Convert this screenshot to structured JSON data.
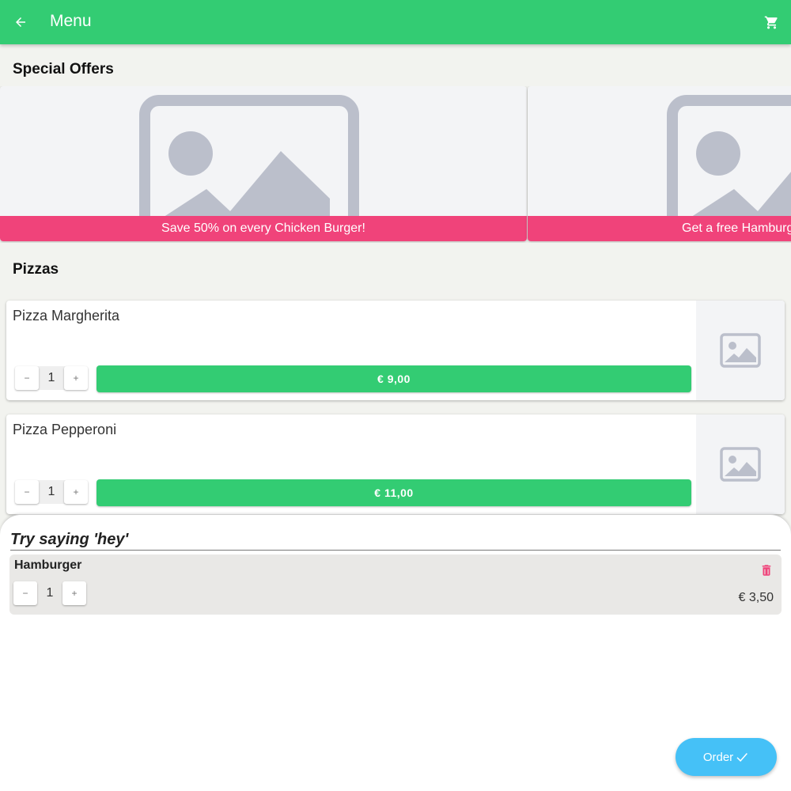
{
  "appbar": {
    "title": "Menu",
    "back_icon": "arrow-left-icon",
    "cart_icon": "cart-icon",
    "color": "#33cc73"
  },
  "offers": {
    "title": "Special Offers",
    "items": [
      {
        "label": "Save 50% on every Chicken Burger!"
      },
      {
        "label": "Get a free Hamburger"
      }
    ],
    "banner_color": "#f0437a"
  },
  "category": {
    "title": "Pizzas",
    "items": [
      {
        "name": "Pizza Margherita",
        "quantity": "1",
        "price": "€ 9,00"
      },
      {
        "name": "Pizza Pepperoni",
        "quantity": "1",
        "price": "€ 11,00"
      }
    ]
  },
  "stepper": {
    "minus": "−",
    "plus": "+"
  },
  "sheet": {
    "voice_placeholder": "Try saying 'hey'",
    "order_items": [
      {
        "name": "Hamburger",
        "quantity": "1",
        "price": "€ 3,50"
      }
    ],
    "order_button": "Order",
    "order_icon": "checkmark-icon",
    "delete_icon": "trash-icon",
    "order_button_color": "#45c1f7"
  }
}
